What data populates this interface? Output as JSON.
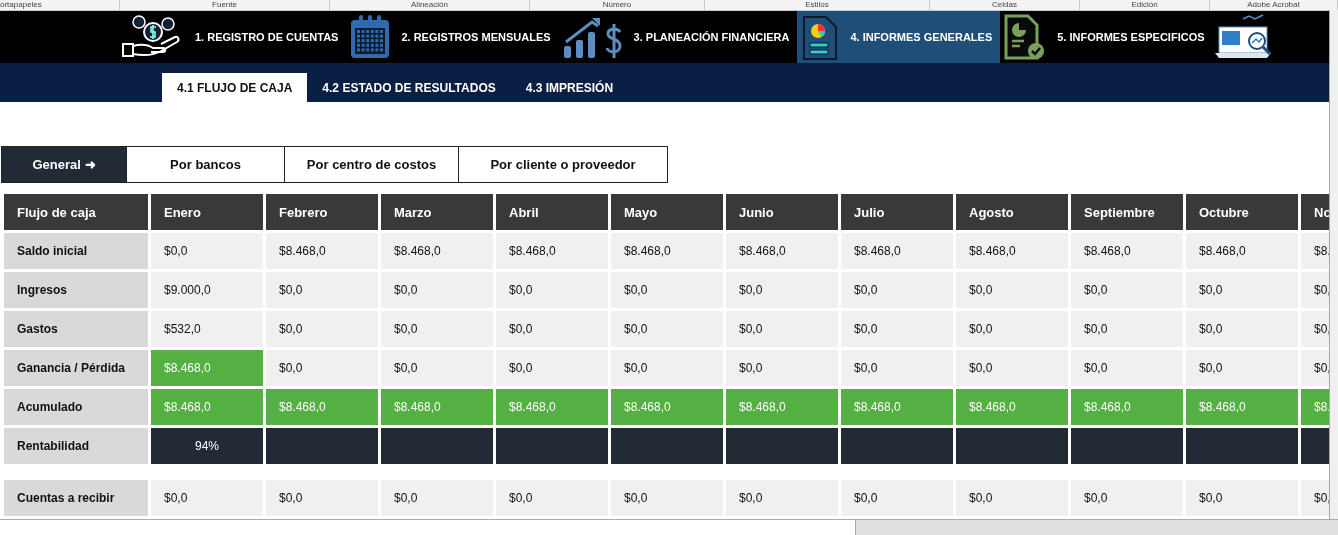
{
  "ribbon_groups": [
    "ortapapeles",
    "Fuente",
    "Alineación",
    "Número",
    "Estilos",
    "Celdas",
    "Edición",
    "Adobe Acrobat"
  ],
  "nav": [
    {
      "label": "1. REGISTRO DE CUENTAS",
      "selected": false
    },
    {
      "label": "2. REGISTROS MENSUALES",
      "selected": false
    },
    {
      "label": "3. PLANEACIÓN FINANCIERA",
      "selected": false
    },
    {
      "label": "4. INFORMES GENERALES",
      "selected": true
    },
    {
      "label": "5. INFORMES ESPECIFICOS",
      "selected": false
    }
  ],
  "subtabs": [
    {
      "label": "4.1 FLUJO DE CAJA",
      "selected": true
    },
    {
      "label": "4.2 ESTADO DE RESULTADOS",
      "selected": false
    },
    {
      "label": "4.3 IMPRESIÓN",
      "selected": false
    }
  ],
  "filters": [
    {
      "label": "General ➜",
      "selected": true
    },
    {
      "label": "Por bancos",
      "selected": false
    },
    {
      "label": "Por centro de costos",
      "selected": false
    },
    {
      "label": "Por cliente o proveedor",
      "selected": false
    }
  ],
  "table": {
    "columns": [
      "Flujo de caja",
      "Enero",
      "Febrero",
      "Marzo",
      "Abril",
      "Mayo",
      "Junio",
      "Julio",
      "Agosto",
      "Septiembre",
      "Octubre",
      "No"
    ],
    "rows": [
      {
        "kind": "money",
        "cells": [
          {
            "text": "Saldo inicial"
          },
          {
            "text": "$0,0",
            "positive": false
          },
          {
            "text": "$8.468,0",
            "positive": false
          },
          {
            "text": "$8.468,0",
            "positive": false
          },
          {
            "text": "$8.468,0",
            "positive": false
          },
          {
            "text": "$8.468,0",
            "positive": false
          },
          {
            "text": "$8.468,0",
            "positive": false
          },
          {
            "text": "$8.468,0",
            "positive": false
          },
          {
            "text": "$8.468,0",
            "positive": false
          },
          {
            "text": "$8.468,0",
            "positive": false
          },
          {
            "text": "$8.468,0",
            "positive": false
          },
          {
            "text": "$8.",
            "positive": false
          }
        ]
      },
      {
        "kind": "money",
        "cells": [
          {
            "text": "Ingresos"
          },
          {
            "text": "$9.000,0",
            "positive": false
          },
          {
            "text": "$0,0",
            "positive": false
          },
          {
            "text": "$0,0",
            "positive": false
          },
          {
            "text": "$0,0",
            "positive": false
          },
          {
            "text": "$0,0",
            "positive": false
          },
          {
            "text": "$0,0",
            "positive": false
          },
          {
            "text": "$0,0",
            "positive": false
          },
          {
            "text": "$0,0",
            "positive": false
          },
          {
            "text": "$0,0",
            "positive": false
          },
          {
            "text": "$0,0",
            "positive": false
          },
          {
            "text": "$0,",
            "positive": false
          }
        ]
      },
      {
        "kind": "money",
        "cells": [
          {
            "text": "Gastos"
          },
          {
            "text": "$532,0",
            "positive": false
          },
          {
            "text": "$0,0",
            "positive": false
          },
          {
            "text": "$0,0",
            "positive": false
          },
          {
            "text": "$0,0",
            "positive": false
          },
          {
            "text": "$0,0",
            "positive": false
          },
          {
            "text": "$0,0",
            "positive": false
          },
          {
            "text": "$0,0",
            "positive": false
          },
          {
            "text": "$0,0",
            "positive": false
          },
          {
            "text": "$0,0",
            "positive": false
          },
          {
            "text": "$0,0",
            "positive": false
          },
          {
            "text": "$0,",
            "positive": false
          }
        ]
      },
      {
        "kind": "money",
        "cells": [
          {
            "text": "Ganancia / Pérdida"
          },
          {
            "text": "$8.468,0",
            "positive": true
          },
          {
            "text": "$0,0",
            "positive": false
          },
          {
            "text": "$0,0",
            "positive": false
          },
          {
            "text": "$0,0",
            "positive": false
          },
          {
            "text": "$0,0",
            "positive": false
          },
          {
            "text": "$0,0",
            "positive": false
          },
          {
            "text": "$0,0",
            "positive": false
          },
          {
            "text": "$0,0",
            "positive": false
          },
          {
            "text": "$0,0",
            "positive": false
          },
          {
            "text": "$0,0",
            "positive": false
          },
          {
            "text": "$0,",
            "positive": false
          }
        ]
      },
      {
        "kind": "money",
        "cells": [
          {
            "text": "Acumulado"
          },
          {
            "text": "$8.468,0",
            "positive": true
          },
          {
            "text": "$8.468,0",
            "positive": true
          },
          {
            "text": "$8.468,0",
            "positive": true
          },
          {
            "text": "$8.468,0",
            "positive": true
          },
          {
            "text": "$8.468,0",
            "positive": true
          },
          {
            "text": "$8.468,0",
            "positive": true
          },
          {
            "text": "$8.468,0",
            "positive": true
          },
          {
            "text": "$8.468,0",
            "positive": true
          },
          {
            "text": "$8.468,0",
            "positive": true
          },
          {
            "text": "$8.468,0",
            "positive": true
          },
          {
            "text": "$8.",
            "positive": true
          }
        ]
      },
      {
        "kind": "ratio",
        "cells": [
          {
            "text": "Rentabilidad"
          },
          {
            "text": "94%"
          }
        ]
      },
      {
        "kind": "money",
        "cells": [
          {
            "text": "Cuentas a recibir"
          },
          {
            "text": "$0,0",
            "positive": false
          },
          {
            "text": "$0,0",
            "positive": false
          },
          {
            "text": "$0,0",
            "positive": false
          },
          {
            "text": "$0,0",
            "positive": false
          },
          {
            "text": "$0,0",
            "positive": false
          },
          {
            "text": "$0,0",
            "positive": false
          },
          {
            "text": "$0,0",
            "positive": false
          },
          {
            "text": "$0,0",
            "positive": false
          },
          {
            "text": "$0,0",
            "positive": false
          },
          {
            "text": "$0,0",
            "positive": false
          },
          {
            "text": "$0,",
            "positive": false
          }
        ]
      }
    ]
  }
}
